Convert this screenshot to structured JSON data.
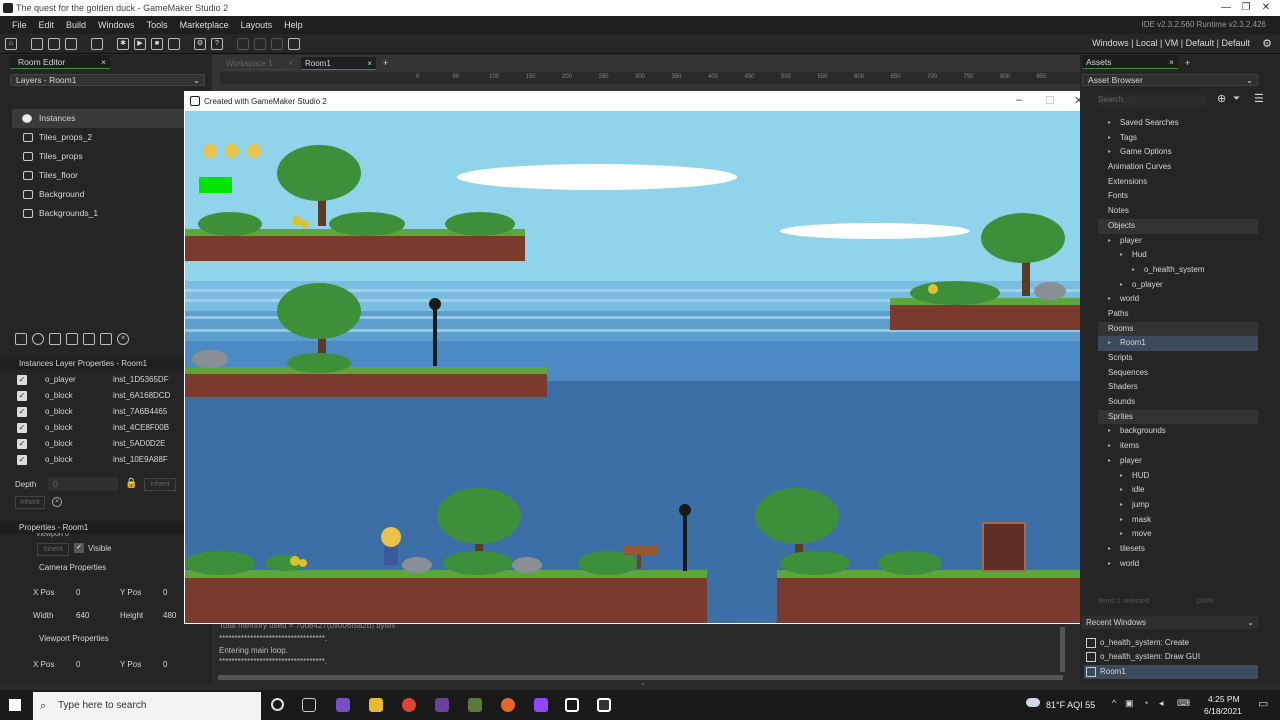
{
  "window": {
    "title": "The quest for the golden duck - GameMaker Studio 2"
  },
  "menu": [
    "File",
    "Edit",
    "Build",
    "Windows",
    "Tools",
    "Marketplace",
    "Layouts",
    "Help"
  ],
  "ide_version": "IDE v2.3.2.560  Runtime v2.3.2.426",
  "targets": "Windows | Local | VM | Default | Default",
  "left": {
    "tab": "Room Editor",
    "layers_dropdown": "Layers - Room1",
    "layers": [
      "Instances",
      "Tiles_props_2",
      "Tiles_props",
      "Tiles_floor",
      "Background",
      "Backgrounds_1"
    ],
    "inst_header": "Instances Layer Properties - Room1",
    "instances": [
      {
        "name": "o_player",
        "id": "inst_1D5365DF"
      },
      {
        "name": "o_block",
        "id": "inst_6A168DCD"
      },
      {
        "name": "o_block",
        "id": "inst_7A6B4465"
      },
      {
        "name": "o_block",
        "id": "inst_4CE8F00B"
      },
      {
        "name": "o_block",
        "id": "inst_5AD0D2E"
      },
      {
        "name": "o_block",
        "id": "inst_10E9A88F"
      }
    ],
    "depth_label": "Depth",
    "depth_value": "0",
    "inherit": "Inherit",
    "props_header": "Properties - Room1",
    "viewport": "Viewport 0",
    "visible": "Visible",
    "camera_props": "Camera Properties",
    "xpos_label": "X Pos",
    "xpos": "0",
    "ypos_label": "Y Pos",
    "ypos": "0",
    "width_label": "Width",
    "width": "640",
    "height_label": "Height",
    "height": "480",
    "viewport_props": "Viewport Properties",
    "vxpos": "0",
    "vypos": "0"
  },
  "center": {
    "tabs": [
      "Workspace 1",
      "Room1"
    ],
    "ruler": [
      "0",
      "50",
      "100",
      "150",
      "200",
      "250",
      "300",
      "350",
      "400",
      "450",
      "500",
      "550",
      "600",
      "650",
      "700",
      "750",
      "800",
      "850"
    ],
    "output": [
      "Total memory used = 7008427(0x006f5a2b) bytes",
      "**********************************.",
      "Entering main loop.",
      "**********************************."
    ]
  },
  "game": {
    "caption": "Created with GameMaker Studio 2"
  },
  "right": {
    "tab": "Assets",
    "dropdown": "Asset Browser",
    "search_placeholder": "Search...",
    "tree": [
      {
        "t": "Saved Searches",
        "lvl": 1
      },
      {
        "t": "Tags",
        "lvl": 1
      },
      {
        "t": "Game Options",
        "lvl": 1
      },
      {
        "t": "Animation Curves",
        "lvl": 0
      },
      {
        "t": "Extensions",
        "lvl": 0
      },
      {
        "t": "Fonts",
        "lvl": 0
      },
      {
        "t": "Notes",
        "lvl": 0
      },
      {
        "t": "Objects",
        "lvl": 0,
        "hl": true
      },
      {
        "t": "player",
        "lvl": 1
      },
      {
        "t": "Hud",
        "lvl": 2
      },
      {
        "t": "o_health_system",
        "lvl": 3
      },
      {
        "t": "o_player",
        "lvl": 2
      },
      {
        "t": "world",
        "lvl": 1
      },
      {
        "t": "Paths",
        "lvl": 0
      },
      {
        "t": "Rooms",
        "lvl": 0,
        "hl": true
      },
      {
        "t": "Room1",
        "lvl": 1,
        "sel": true
      },
      {
        "t": "Scripts",
        "lvl": 0
      },
      {
        "t": "Sequences",
        "lvl": 0
      },
      {
        "t": "Shaders",
        "lvl": 0
      },
      {
        "t": "Sounds",
        "lvl": 0
      },
      {
        "t": "Sprites",
        "lvl": 0,
        "hl": true
      },
      {
        "t": "backgrounds",
        "lvl": 1
      },
      {
        "t": "items",
        "lvl": 1
      },
      {
        "t": "player",
        "lvl": 1
      },
      {
        "t": "HUD",
        "lvl": 2
      },
      {
        "t": "idle",
        "lvl": 2
      },
      {
        "t": "jump",
        "lvl": 2
      },
      {
        "t": "mask",
        "lvl": 2
      },
      {
        "t": "move",
        "lvl": 2
      },
      {
        "t": "tilesets",
        "lvl": 1
      },
      {
        "t": "world",
        "lvl": 1
      }
    ],
    "status": "Items  1 selected",
    "zoom": "100%",
    "recent_header": "Recent Windows",
    "recent": [
      "o_health_system: Create",
      "o_health_system: Draw GUI",
      "Room1"
    ]
  },
  "taskbar": {
    "search": "Type here to search",
    "weather": "81°F  AQI 55",
    "time": "4:25 PM",
    "date": "6/18/2021"
  }
}
